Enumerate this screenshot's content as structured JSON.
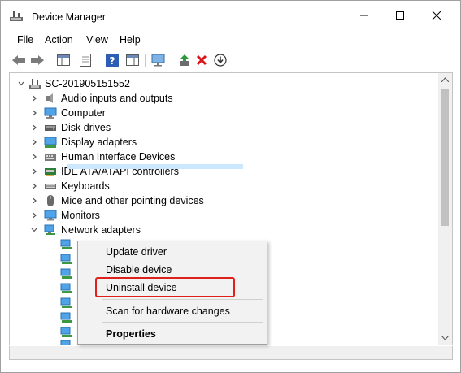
{
  "window": {
    "title": "Device Manager"
  },
  "menu": [
    "File",
    "Action",
    "View",
    "Help"
  ],
  "tree": {
    "root": "SC-201905151552",
    "categories": [
      {
        "label": "Audio inputs and outputs",
        "icon": "speaker-icon"
      },
      {
        "label": "Computer",
        "icon": "computer-icon"
      },
      {
        "label": "Disk drives",
        "icon": "disk-drive-icon"
      },
      {
        "label": "Display adapters",
        "icon": "display-adapter-icon"
      },
      {
        "label": "Human Interface Devices",
        "icon": "hid-icon"
      },
      {
        "label": "IDE ATA/ATAPI controllers",
        "icon": "ide-controller-icon"
      },
      {
        "label": "Keyboards",
        "icon": "keyboard-icon"
      },
      {
        "label": "Mice and other pointing devices",
        "icon": "mouse-icon"
      },
      {
        "label": "Monitors",
        "icon": "monitor-icon"
      },
      {
        "label": "Network adapters",
        "icon": "network-adapter-icon"
      }
    ]
  },
  "context_menu": {
    "update": "Update driver",
    "disable": "Disable device",
    "uninstall": "Uninstall device",
    "scan": "Scan for hardware changes",
    "properties": "Properties"
  },
  "colors": {
    "highlight": "#e0201b",
    "selection": "#cce8ff",
    "menu_bg": "#f2f2f2"
  }
}
